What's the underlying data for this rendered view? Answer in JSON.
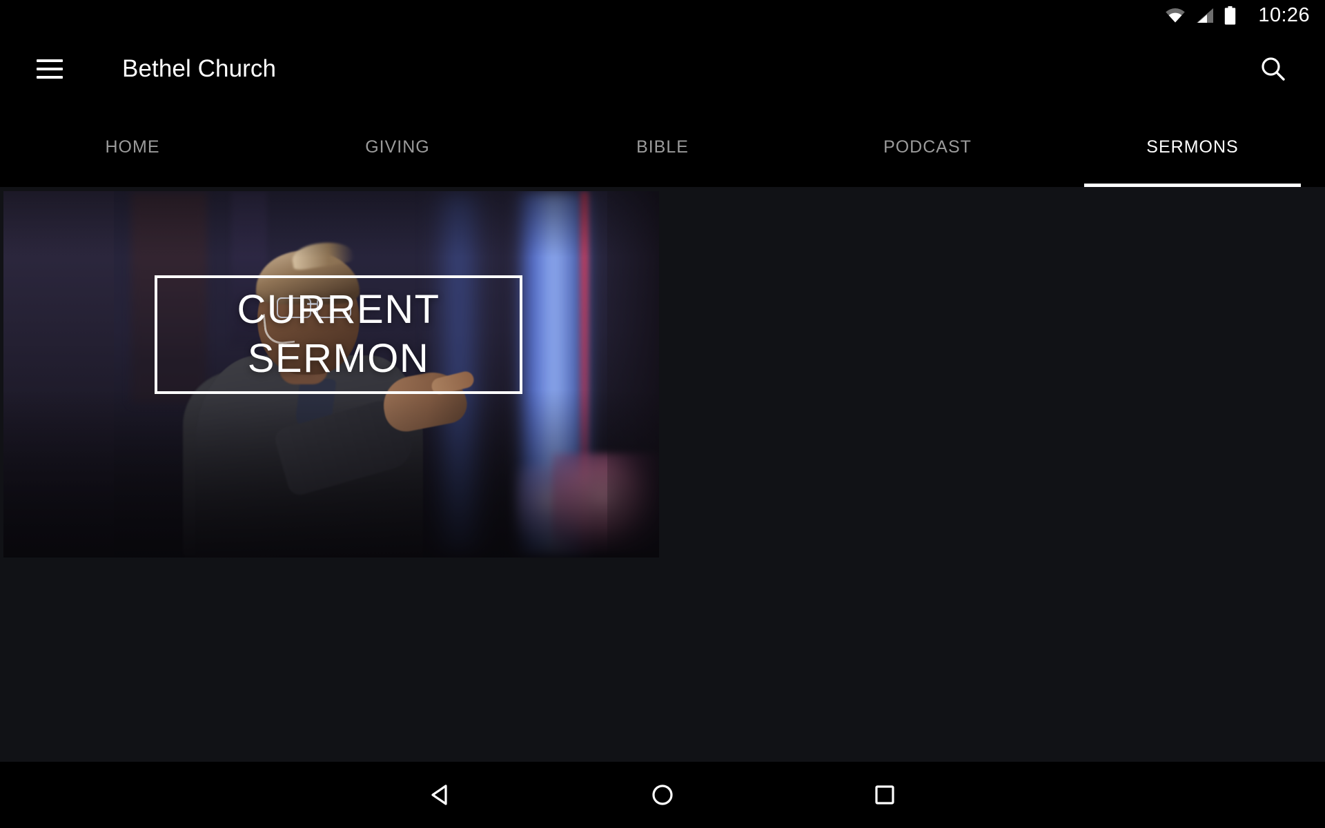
{
  "statusbar": {
    "time": "10:26",
    "icons": [
      {
        "name": "wifi-icon",
        "label": "wifi"
      },
      {
        "name": "cellular-signal-icon",
        "label": "signal"
      },
      {
        "name": "battery-icon",
        "label": "battery-full"
      }
    ]
  },
  "appbar": {
    "title": "Bethel Church",
    "menu_icon": "hamburger-menu-icon",
    "search_icon": "search-icon"
  },
  "tabs": [
    {
      "label": "HOME",
      "active": false
    },
    {
      "label": "GIVING",
      "active": false
    },
    {
      "label": "BIBLE",
      "active": false
    },
    {
      "label": "PODCAST",
      "active": false
    },
    {
      "label": "SERMONS",
      "active": true
    }
  ],
  "main": {
    "card": {
      "overlay_line1": "CURRENT",
      "overlay_line2": "SERMON",
      "image_description": "Speaker with glasses pointing on stage with blue and pink lighting"
    }
  },
  "navbar": {
    "back": "back-button",
    "home": "home-button",
    "recents": "recents-button"
  },
  "colors": {
    "background": "#000000",
    "content_background": "#111216",
    "accent": "#ffffff",
    "tab_inactive": "#9b9b9b",
    "tab_active": "#ffffff"
  }
}
